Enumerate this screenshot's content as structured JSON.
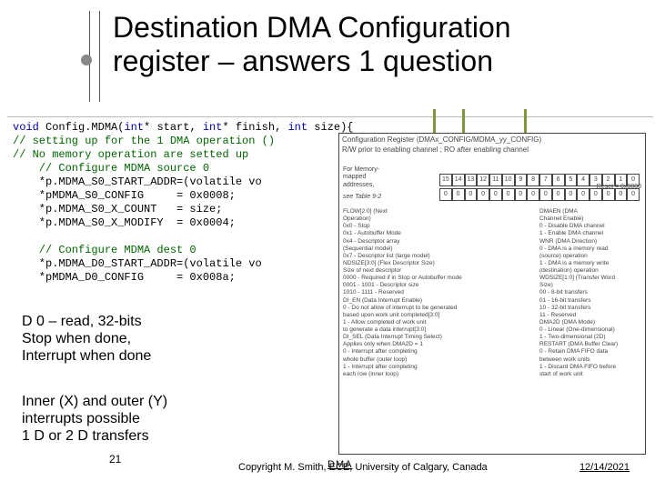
{
  "slide": {
    "title_line1": "Destination DMA Configuration",
    "title_line2": "register – answers 1 question",
    "number": "21",
    "copyright": "Copyright M. Smith, ECE, University of Calgary, Canada",
    "date": "12/14/2021",
    "dma_label": "DMA"
  },
  "code": {
    "l1a": "void",
    "l1b": " Config.MDMA(",
    "l1c": "int",
    "l1d": "* start, ",
    "l1e": "int",
    "l1f": "* finish, ",
    "l1g": "int",
    "l1h": " size){",
    "l2": "// setting up for the 1 DMA operation ()",
    "l3": "// No memory operation are setted up",
    "l4": "    // Configure MDMA source 0",
    "l5": "    *p.MDMA_S0_START_ADDR=(volatile vo",
    "l6": "    *pMDMA_S0_CONFIG     = 0x0008;",
    "l7": "    *p.MDMA_S0_X_COUNT   = size;",
    "l8": "    *p.MDMA_S0_X_MODIFY  = 0x0004;",
    "l9": "",
    "l10": "    // Configure MDMA dest 0",
    "l11": "    *p.MDMA_D0_START_ADDR=(volatile vo",
    "l12": "    *pMDMA_D0_CONFIG     = 0x008a;"
  },
  "annotation1": {
    "l1": "D 0 – read, 32-bits",
    "l2": "Stop when done,",
    "l3": "Interrupt when done"
  },
  "annotation2": {
    "l1": "Inner (X) and outer (Y)",
    "l2": "interrupts possible",
    "l3": "1 D or 2 D transfers"
  },
  "register": {
    "title": "Configuration Register (DMAx_CONFIG/MDMA_yy_CONFIG)",
    "sub": "R/W prior to enabling channel ; RO after enabling channel",
    "bits": [
      "15",
      "14",
      "13",
      "12",
      "11",
      "10",
      "9",
      "8",
      "7",
      "6",
      "5",
      "4",
      "3",
      "2",
      "1",
      "0"
    ],
    "vals": [
      "0",
      "0",
      "0",
      "0",
      "0",
      "0",
      "0",
      "0",
      "0",
      "0",
      "0",
      "0",
      "0",
      "0",
      "0",
      "0"
    ],
    "reset": "Reset = 0x0000",
    "left1": "For Memory-",
    "left2": "mapped",
    "left3": "addresses,",
    "see": "see Table 9-2",
    "fields": "FLOW[2:0] (Next\nOperation)\n0x0 - Stop\n0x1 - Autobuffer Mode\n0x4 - Descriptor array\n  (Sequential model)\n0x7 - Descriptor list (large model)\nNDSIZE[3:0] (Flex Descriptor Size)\nSize of next descriptor\n0000 - Required if in Stop or Autobuffer mode\n0001 - 1001 - Descriptor size\n1010 - 1111 - Reserved\nDI_EN (Data Interrupt Enable)\n0 - Do not allow of interrupt to be generated\n   based upon work unit completed[3:0]\n1 - Allow completed of work unit\n   to generate a data interrupt[3:0]\nDI_SEL (Data Interrupt Timing Select)\nApplies only when DMA2D = 1\n0 - Interrupt after completing\n   whole buffer (outer loop)\n1 - Interrupt after completing\n   each row (inner loop)",
    "right": "DMAEN (DMA\nChannel Enable)\n0 - Disable DMA channel\n1 - Enable DMA channel\nWNR (DMA Direction)\n0 - DMA is a memory read\n  (source) operation\n1 - DMA is a memory write\n  (destination) operation\nWDSIZE[1:0] (Transfer Word\nSize)\n00 - 8-bit transfers\n01 - 16-bit transfers\n10 - 32-bit transfers\n11 - Reserved\nDMA2D (DMA Mode)\n0 - Linear (One-dimensional)\n1 - Two-dimensional (2D)\nRESTART (DMA Buffer Clear)\n0 - Retain DMA FIFO data\n  between work units\n1 - Discard DMA FIFO before\n  start of work unit"
  }
}
